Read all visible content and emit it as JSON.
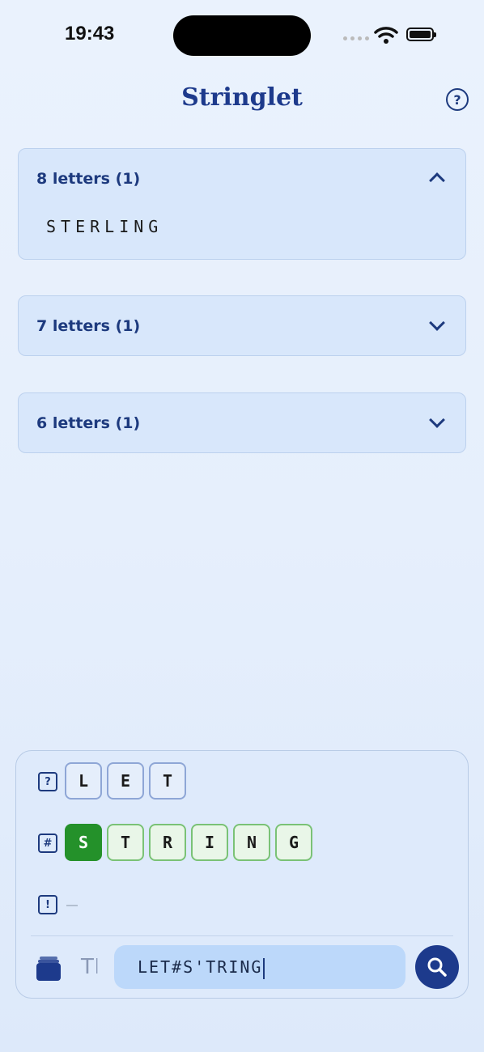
{
  "status": {
    "time": "19:43"
  },
  "header": {
    "title": "Stringlet",
    "help_icon": "question-circle-icon"
  },
  "groups": [
    {
      "label": "8 letters (1)",
      "expanded": true,
      "words": [
        "STERLING"
      ]
    },
    {
      "label": "7 letters (1)",
      "expanded": false
    },
    {
      "label": "6 letters (1)",
      "expanded": false
    }
  ],
  "panel": {
    "rows": [
      {
        "icon": "?",
        "icon_name": "question-box-icon",
        "tiles": [
          "L",
          "E",
          "T"
        ]
      },
      {
        "icon": "#",
        "icon_name": "hash-box-icon",
        "tiles": [
          "S",
          "T",
          "R",
          "I",
          "N",
          "G"
        ]
      },
      {
        "icon": "!",
        "icon_name": "exclamation-box-icon",
        "tiles": []
      }
    ],
    "search_value": "LET#S'TRING"
  },
  "colors": {
    "accent": "#1d3a8c",
    "green": "#24912a",
    "tile_blue_border": "#8ea6d6",
    "tile_green_border": "#7ac276"
  }
}
